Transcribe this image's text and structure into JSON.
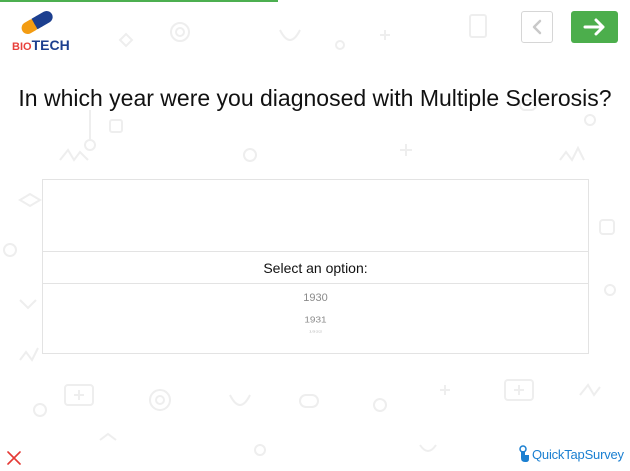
{
  "logo": {
    "prefix": "BIO",
    "suffix": "TECH"
  },
  "nav": {
    "back_icon": "chevron-left-icon",
    "next_icon": "arrow-right-icon",
    "next_color": "#4cae4c"
  },
  "question": {
    "text": "In which year were you diagnosed with Multiple Sclerosis?"
  },
  "picker": {
    "header": "Select an option:",
    "options": [
      "1930",
      "1931",
      "1932"
    ]
  },
  "footer": {
    "close_icon": "close-icon",
    "brand": "QuickTapSurvey"
  },
  "colors": {
    "accent_green": "#4cae4c",
    "brand_blue": "#1a7fd1",
    "close_red": "#e53935"
  }
}
